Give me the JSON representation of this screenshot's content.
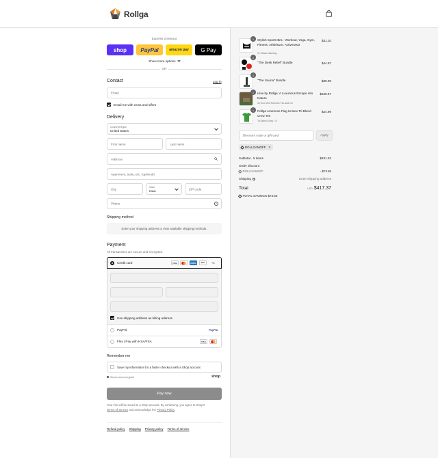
{
  "brand": {
    "name": "Rollga"
  },
  "express": {
    "title": "Express checkout",
    "shop_label": "shop",
    "paypal_label": "PayPal",
    "amazon_label": "amazon pay",
    "gpay_label": "G Pay",
    "more_label": "Show more options",
    "or_label": "OR"
  },
  "contact": {
    "heading": "Contact",
    "login_label": "Log in",
    "email_placeholder": "Email",
    "news_label": "Email me with news and offers"
  },
  "delivery": {
    "heading": "Delivery",
    "country_label": "Country/Region",
    "country_value": "United States",
    "first_name": "First name",
    "last_name": "Last name",
    "address": "Address",
    "apartment": "Apartment, suite, etc. (optional)",
    "city": "City",
    "state_label": "State",
    "state_value": "Iowa",
    "zip": "ZIP code",
    "phone": "Phone"
  },
  "shipping_method": {
    "heading": "Shipping method",
    "notice": "Enter your shipping address to view available shipping methods."
  },
  "payment": {
    "heading": "Payment",
    "subtitle": "All transactions are secure and encrypted.",
    "credit_card": "Credit card",
    "card_more": "+4",
    "billing_label": "Use shipping address as billing address",
    "paypal": "PayPal",
    "paypal_logo": "PayPal",
    "flex": "Flex | Pay with HSA/FSA"
  },
  "remember": {
    "heading": "Remember me",
    "save_label": "Save my information for a faster checkout with a Shop account",
    "secure": "Secure and encrypted",
    "shop_logo": "shop"
  },
  "pay_button": "Pay now",
  "terms": {
    "line1": "Your info will be saved to a Shop account. By continuing, you agree to Shop's",
    "terms_link": "Terms of Service",
    "and_text": "and acknowledge the",
    "privacy_link": "Privacy Policy",
    "period": "."
  },
  "footer_links": [
    "Refund policy",
    "Shipping",
    "Privacy policy",
    "Terms of service"
  ],
  "products": [
    {
      "title": "Stylish Sports Bra - Workout, Yoga, Gym, Fitness, Athleisure, Activewear",
      "variant": "S / Black stitching",
      "price": "$31.10",
      "qty": "1"
    },
    {
      "title": "\"The Desk Relief\" Bundle",
      "variant": "",
      "price": "$44.97",
      "qty": "1"
    },
    {
      "title": "\"The Sauna\" Bundle",
      "variant": "",
      "price": "$39.99",
      "qty": "1"
    },
    {
      "title": "Hive by Rollga: A Luxurious Escape into Nature",
      "variant": "3-Hour Mini Retreat / No Add On",
      "price": "$349.97",
      "qty": "1"
    },
    {
      "title": "Rollga American Flag Unisex Tri-Blend Crew Tee",
      "variant": "Tri-Blend Grey / S",
      "price": "$24.99",
      "qty": "1"
    }
  ],
  "discount": {
    "placeholder": "Discount code or gift card",
    "apply": "Apply",
    "code": "ROLLGAMOFF"
  },
  "summary": {
    "subtotal_label": "Subtotal · 5 items",
    "subtotal_value": "$491.02",
    "order_discount_label": "Order discount",
    "discount_code": "ROLLGAMOFF",
    "discount_value": "- $73.65",
    "shipping_label": "Shipping",
    "shipping_value": "Enter shipping address",
    "total_label": "Total",
    "currency": "USD",
    "total_value": "$417.37",
    "savings_label": "TOTAL SAVINGS",
    "savings_value": "$73.65"
  },
  "colors": {
    "shop": "#5a31f4",
    "paypal": "#ffc439",
    "amazon": "#ffd814",
    "pay_button": "#8c8c8c",
    "sidebar_bg": "#f5f5f5"
  }
}
